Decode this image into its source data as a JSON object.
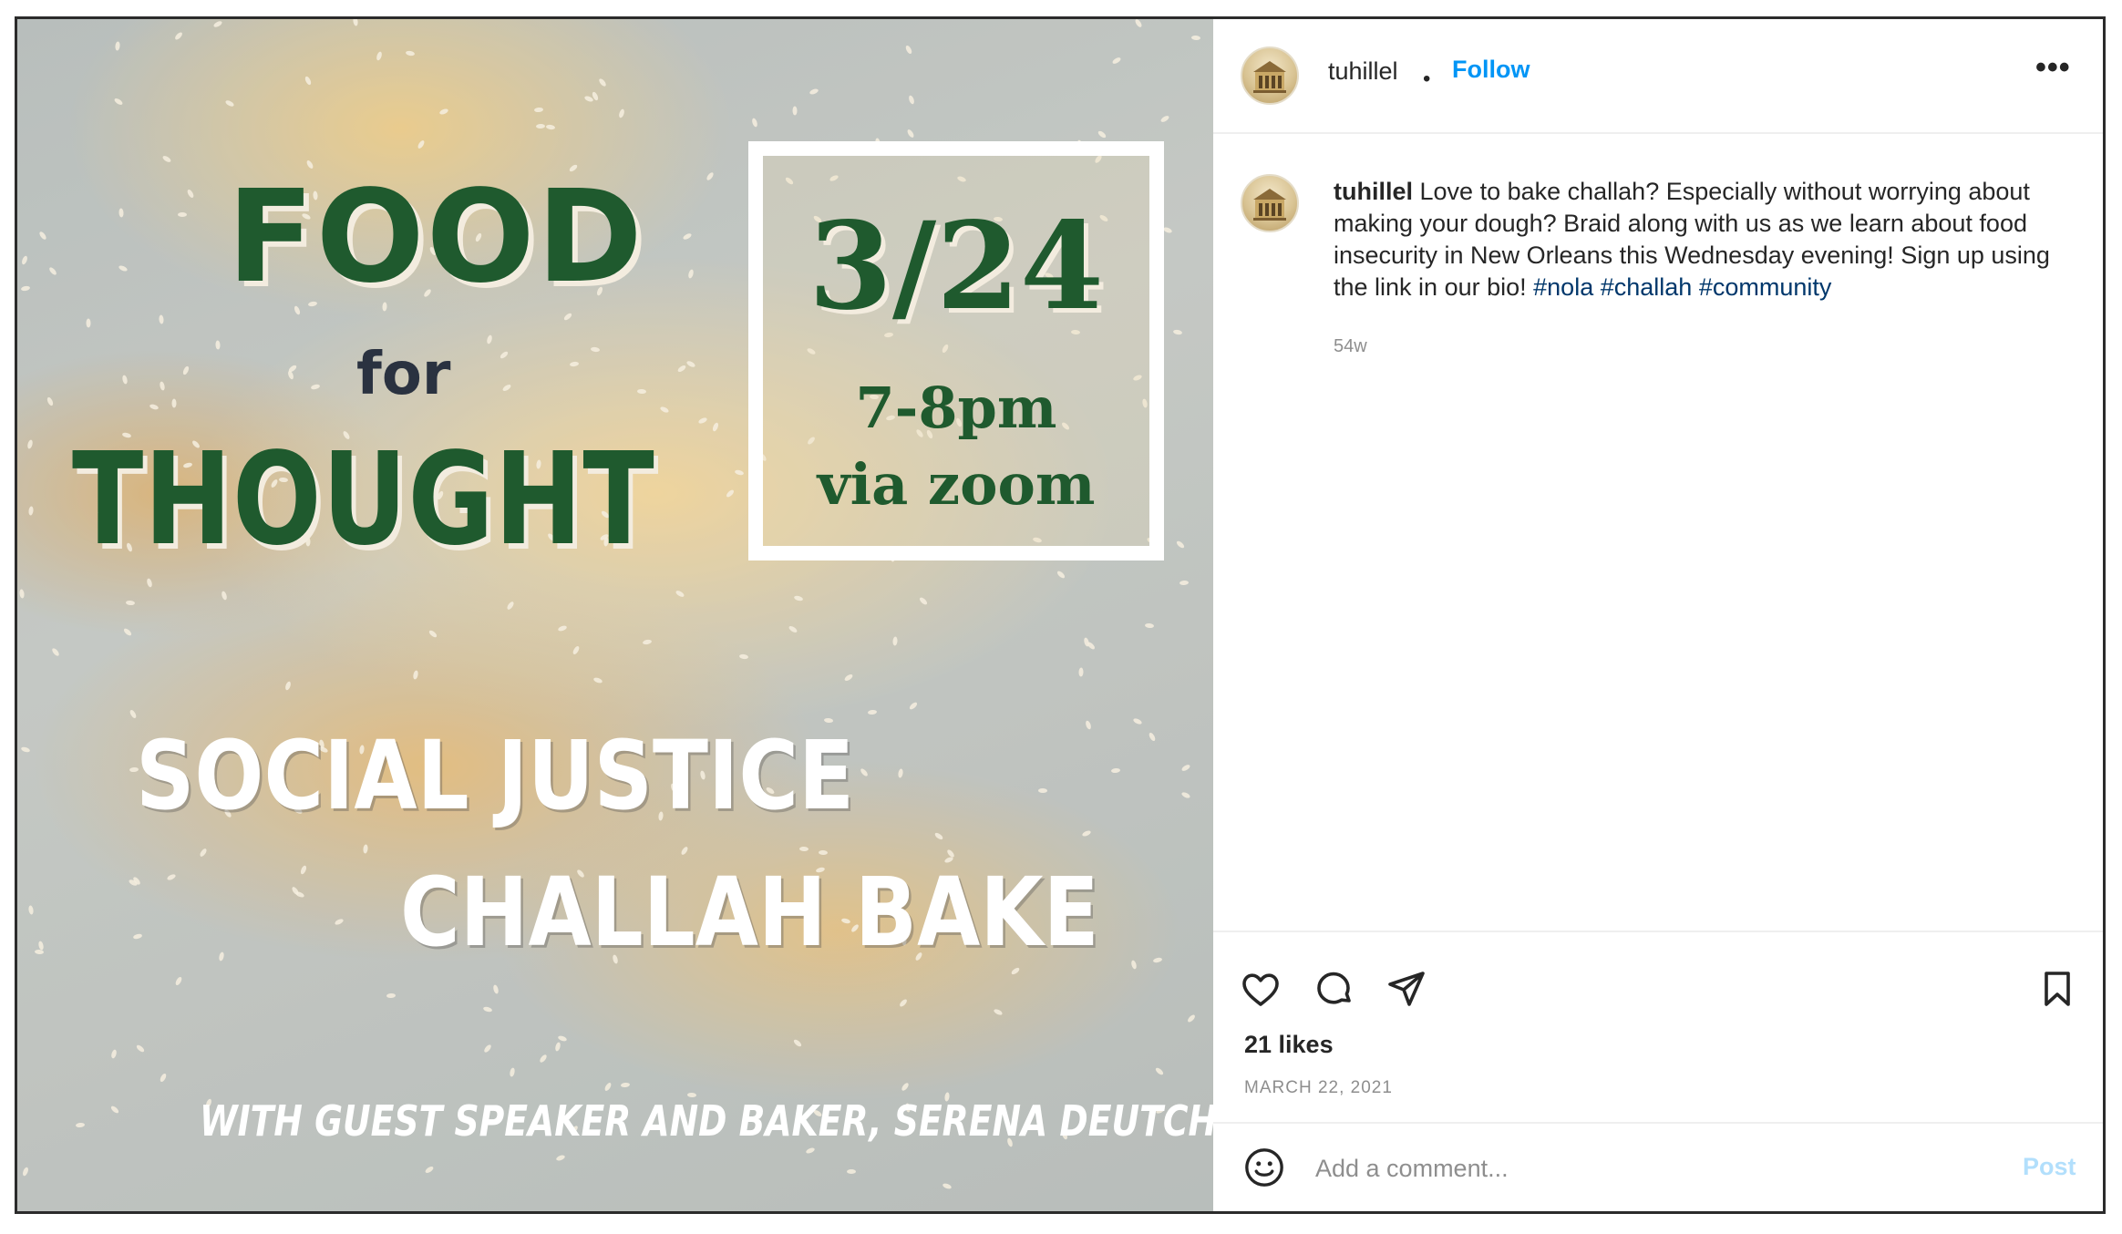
{
  "post_image": {
    "title_line1": "FOOD",
    "title_line2": "for",
    "title_line3": "THOUGHT",
    "date": "3/24",
    "time": "7-8pm",
    "platform": "via zoom",
    "event_line1": "SOCIAL JUSTICE",
    "event_line2": "CHALLAH BAKE",
    "guest": "WITH GUEST SPEAKER AND BAKER, SERENA DEUTCH"
  },
  "header": {
    "username": "tuhillel",
    "separator": "•",
    "follow_label": "Follow",
    "more_icon": "more-options-icon",
    "more_glyph": "•••"
  },
  "caption": {
    "username": "tuhillel",
    "text": "Love to bake challah? Especially without worrying about making your dough? Braid along with us as we learn about food insecurity in New Orleans this Wednesday evening! Sign up using the link in our bio!",
    "hashtags": [
      "#nola",
      "#challah",
      "#community"
    ],
    "age": "54w"
  },
  "actions": {
    "icons": [
      "heart-icon",
      "comment-icon",
      "share-icon",
      "bookmark-icon"
    ]
  },
  "likes": "21 likes",
  "post_date": "MARCH 22, 2021",
  "comment": {
    "emoji_icon": "emoji-icon",
    "placeholder": "Add a comment...",
    "value": "",
    "post_label": "Post"
  },
  "colors": {
    "accent": "#0095f6",
    "post_disabled": "#b2dffc",
    "hashtag": "#00376b",
    "title_green": "#1f5a2e"
  }
}
